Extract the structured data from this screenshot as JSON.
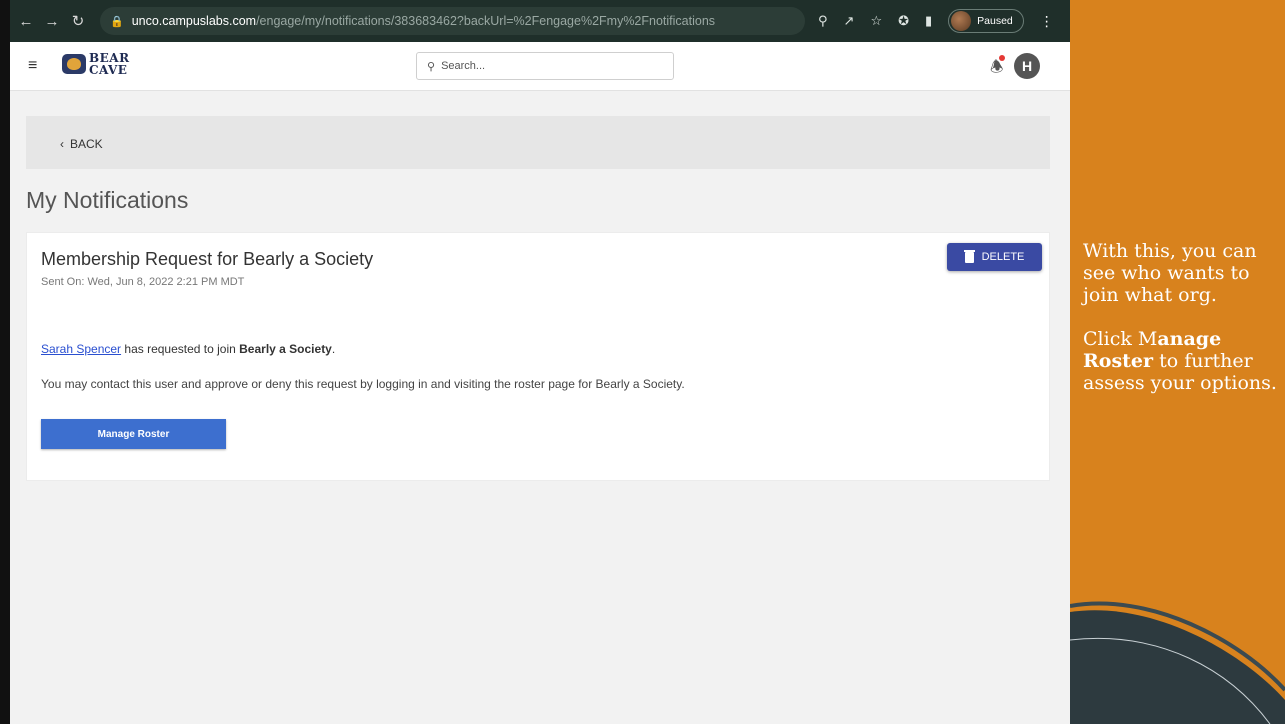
{
  "browser": {
    "url_host": "unco.campuslabs.com",
    "url_path": "/engage/my/notifications/383683462?backUrl=%2Fengage%2Fmy%2Fnotifications",
    "profile_status": "Paused"
  },
  "header": {
    "logo_line1": "BEAR",
    "logo_line2": "CAVE",
    "search_placeholder": "Search...",
    "avatar_initial": "H"
  },
  "back": {
    "label": "BACK"
  },
  "page": {
    "title": "My Notifications"
  },
  "notification": {
    "title": "Membership Request for Bearly a Society",
    "sent_on": "Sent On: Wed, Jun 8, 2022 2:21 PM MDT",
    "delete_label": "DELETE",
    "user_name": "Sarah Spencer",
    "request_text": " has requested to join ",
    "org_name": "Bearly a Society",
    "request_end": ".",
    "instructions": "You may contact this user and approve or deny this request by logging in and visiting the roster page for Bearly a Society.",
    "manage_label": "Manage Roster"
  },
  "side_panel": {
    "paragraph1": "With this, you can see who wants to join what org.",
    "p2_start": "Click M",
    "p2_bold": "anage Roster",
    "p2_end": " to further assess your options."
  },
  "colors": {
    "panel_orange": "#d8821d",
    "delete_blue": "#3a4aa3",
    "manage_blue": "#3d6fcf",
    "chrome_dark": "#1f2f2a"
  }
}
